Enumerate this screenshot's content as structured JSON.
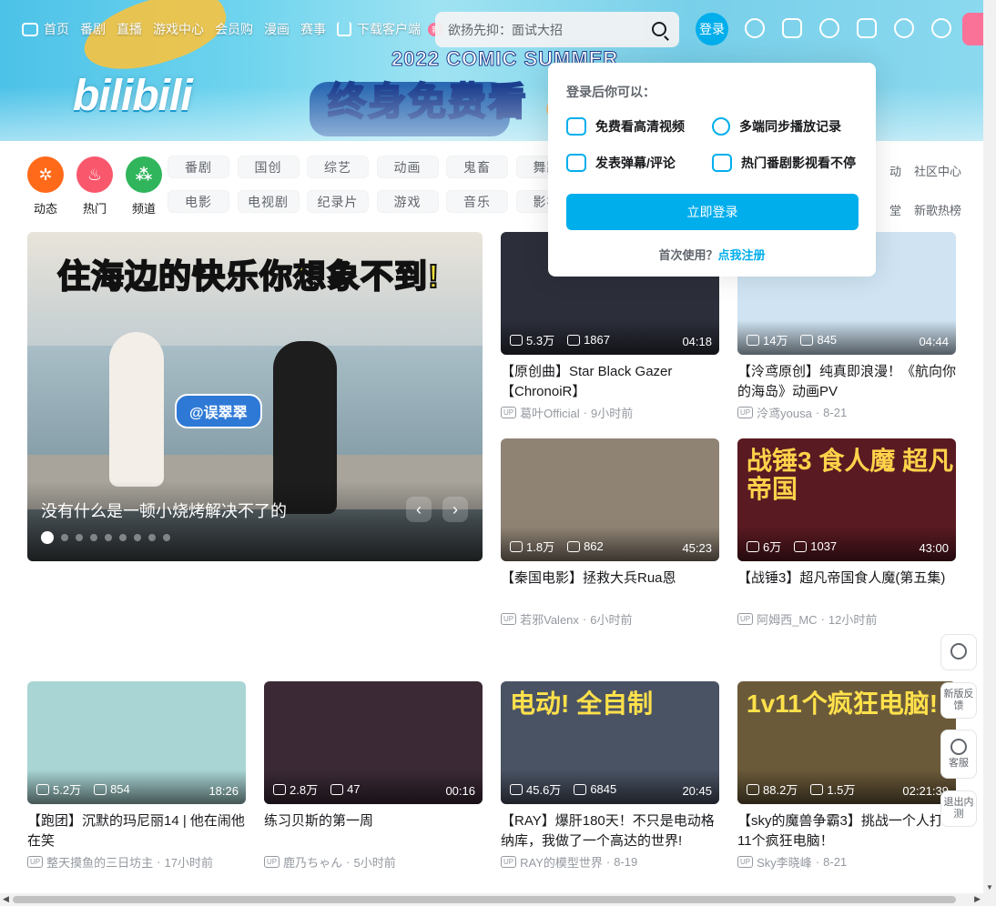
{
  "nav": {
    "items": [
      "首页",
      "番剧",
      "直播",
      "游戏中心",
      "会员购",
      "漫画",
      "赛事"
    ],
    "download_label": "下载客户端",
    "download_badge": "新",
    "search_placeholder": "欲扬先抑：面试大招",
    "login_label": "登录"
  },
  "banner": {
    "logo": "bilibili",
    "subhead": "2022 COMIC SUMMER",
    "headline": "终身免费看"
  },
  "popover": {
    "title": "登录后你可以：",
    "features": [
      "免费看高清视频",
      "多端同步播放记录",
      "发表弹幕/评论",
      "热门番剧影视看不停"
    ],
    "button": "立即登录",
    "first_use": "首次使用？",
    "register": "点我注册"
  },
  "channels": [
    {
      "label": "动态",
      "color": "#ff6a1a"
    },
    {
      "label": "热门",
      "color": "#f9576c"
    },
    {
      "label": "频道",
      "color": "#30b55c"
    }
  ],
  "categories": {
    "row1": [
      "番剧",
      "国创",
      "综艺",
      "动画",
      "鬼畜",
      "舞蹈"
    ],
    "row2": [
      "电影",
      "电视剧",
      "纪录片",
      "游戏",
      "音乐",
      "影视"
    ]
  },
  "links": {
    "row1": [
      "动",
      "社区中心"
    ],
    "row2": [
      "堂",
      "新歌热榜"
    ]
  },
  "carousel": {
    "title_a": "住海边的快乐",
    "title_b": "你想象不到!",
    "tag": "@误翠翠",
    "caption": "没有什么是一顿小烧烤解决不了的",
    "dots_total": 9,
    "active_dot": 1
  },
  "videos": [
    {
      "title": "【原创曲】Star Black Gazer【ChronoiR】",
      "views": "5.3万",
      "danmaku": "1867",
      "duration": "04:18",
      "author": "葛叶Official",
      "time": "9小时前",
      "bg": "#2c2e3a",
      "overlay": "",
      "overlay_color": "#fff"
    },
    {
      "title": "【泠鸢原创】纯真即浪漫！《航向你的海岛》动画PV",
      "views": "14万",
      "danmaku": "845",
      "duration": "04:44",
      "author": "泠鸢yousa",
      "time": "8-21",
      "bg": "#cfe3f2",
      "overlay": "",
      "overlay_color": "#fff"
    },
    {
      "title": "【秦国电影】拯救大兵Rua恩",
      "views": "1.8万",
      "danmaku": "862",
      "duration": "45:23",
      "author": "若邪Valenx",
      "time": "6小时前",
      "bg": "#8f8374",
      "overlay": "",
      "overlay_color": "#fff"
    },
    {
      "title": "【战锤3】超凡帝国食人魔(第五集)",
      "views": "6万",
      "danmaku": "1037",
      "duration": "43:00",
      "author": "阿姆西_MC",
      "time": "12小时前",
      "bg": "#5a1a22",
      "overlay": "战锤3 食人魔 超凡帝国",
      "overlay_color": "#ffd24a"
    },
    {
      "title": "【跑团】沉默的玛尼丽14 | 他在闹他在笑",
      "views": "5.2万",
      "danmaku": "854",
      "duration": "18:26",
      "author": "整天摸鱼的三日坊主",
      "time": "17小时前",
      "bg": "#a9d6d5",
      "overlay": "",
      "overlay_color": "#fff"
    },
    {
      "title": "练习贝斯的第一周",
      "views": "2.8万",
      "danmaku": "47",
      "duration": "00:16",
      "author": "鹿乃ちゃん",
      "time": "5小时前",
      "bg": "#3b2a36",
      "overlay": "",
      "overlay_color": "#fff"
    },
    {
      "title": "【RAY】爆肝180天！不只是电动格纳库，我做了一个高达的世界!",
      "views": "45.6万",
      "danmaku": "6845",
      "duration": "20:45",
      "author": "RAY的模型世界",
      "time": "8-19",
      "bg": "#4a5364",
      "overlay": "电动! 全自制",
      "overlay_color": "#ffe14a"
    },
    {
      "title": "【sky的魔兽争霸3】挑战一个人打11个疯狂电脑！",
      "views": "88.2万",
      "danmaku": "1.5万",
      "duration": "02:21:39",
      "author": "Sky李晓峰",
      "time": "8-21",
      "bg": "#6b5a3a",
      "overlay": "1v11个疯狂电脑!",
      "overlay_color": "#ffe14a"
    }
  ],
  "float": {
    "feedback": "新版反馈",
    "service": "客服",
    "exit": "退出内测"
  },
  "colors": {
    "accent": "#00aeec",
    "pink": "#fb7299"
  }
}
